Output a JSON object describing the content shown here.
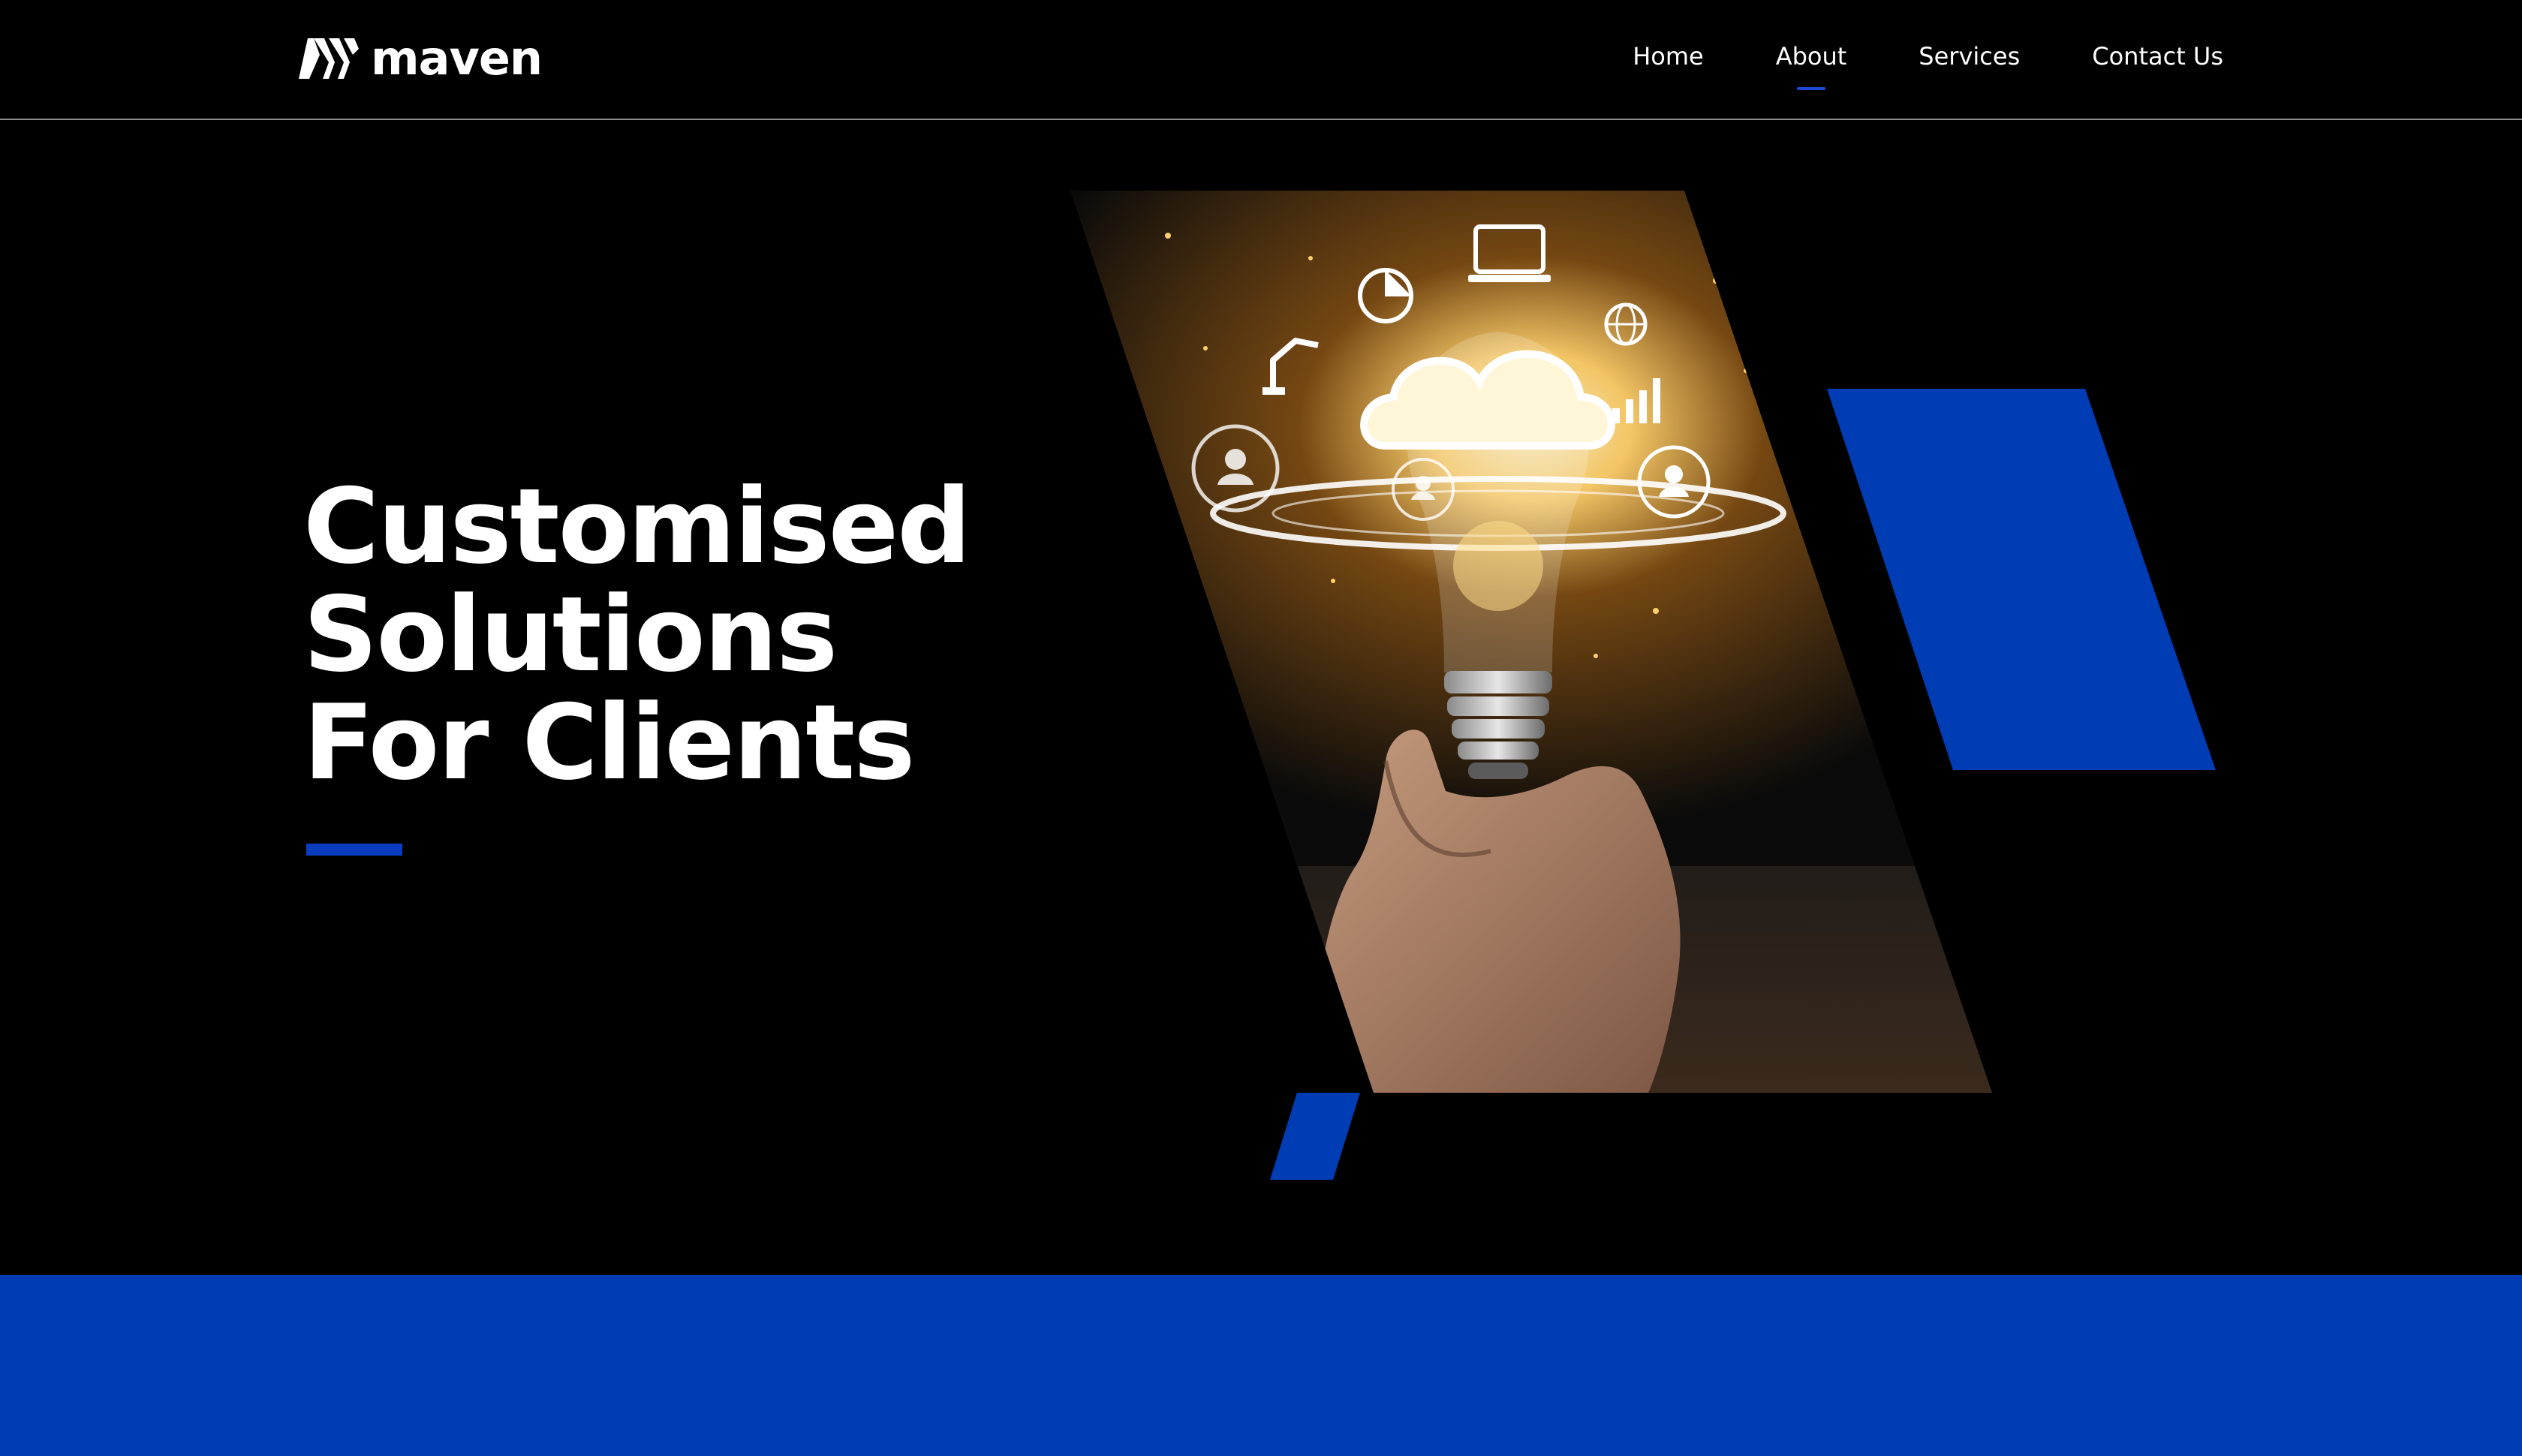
{
  "brand": {
    "name": "maven",
    "accent_color": "#003cb4",
    "background_color": "#000000"
  },
  "nav": {
    "items": [
      {
        "label": "Home",
        "active": false
      },
      {
        "label": "About",
        "active": true
      },
      {
        "label": "Services",
        "active": false
      },
      {
        "label": "Contact Us",
        "active": false
      }
    ]
  },
  "hero": {
    "title_lines": [
      "Customised",
      "Solutions",
      "For Clients"
    ],
    "image_icon": "lightbulb-cloud-illustration"
  }
}
